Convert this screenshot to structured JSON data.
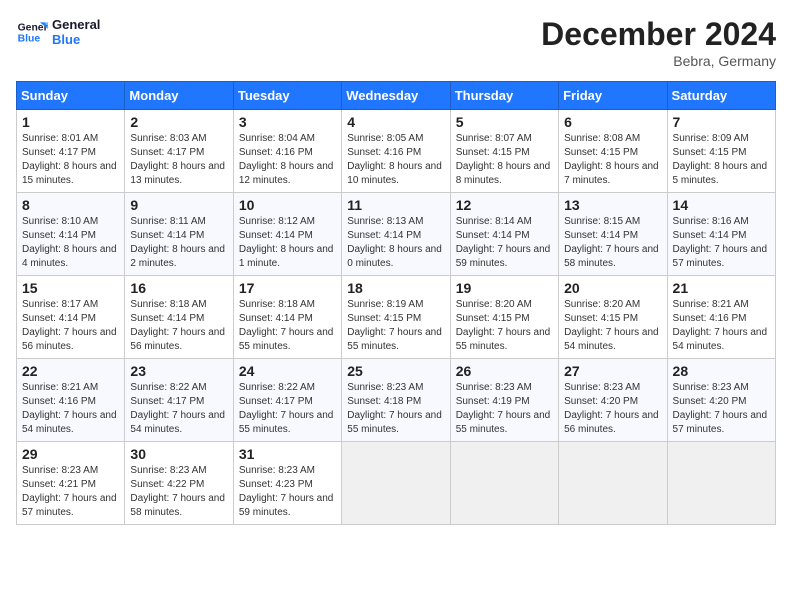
{
  "header": {
    "logo_line1": "General",
    "logo_line2": "Blue",
    "month_year": "December 2024",
    "location": "Bebra, Germany"
  },
  "weekdays": [
    "Sunday",
    "Monday",
    "Tuesday",
    "Wednesday",
    "Thursday",
    "Friday",
    "Saturday"
  ],
  "weeks": [
    [
      {
        "day": "1",
        "info": "Sunrise: 8:01 AM\nSunset: 4:17 PM\nDaylight: 8 hours and 15 minutes."
      },
      {
        "day": "2",
        "info": "Sunrise: 8:03 AM\nSunset: 4:17 PM\nDaylight: 8 hours and 13 minutes."
      },
      {
        "day": "3",
        "info": "Sunrise: 8:04 AM\nSunset: 4:16 PM\nDaylight: 8 hours and 12 minutes."
      },
      {
        "day": "4",
        "info": "Sunrise: 8:05 AM\nSunset: 4:16 PM\nDaylight: 8 hours and 10 minutes."
      },
      {
        "day": "5",
        "info": "Sunrise: 8:07 AM\nSunset: 4:15 PM\nDaylight: 8 hours and 8 minutes."
      },
      {
        "day": "6",
        "info": "Sunrise: 8:08 AM\nSunset: 4:15 PM\nDaylight: 8 hours and 7 minutes."
      },
      {
        "day": "7",
        "info": "Sunrise: 8:09 AM\nSunset: 4:15 PM\nDaylight: 8 hours and 5 minutes."
      }
    ],
    [
      {
        "day": "8",
        "info": "Sunrise: 8:10 AM\nSunset: 4:14 PM\nDaylight: 8 hours and 4 minutes."
      },
      {
        "day": "9",
        "info": "Sunrise: 8:11 AM\nSunset: 4:14 PM\nDaylight: 8 hours and 2 minutes."
      },
      {
        "day": "10",
        "info": "Sunrise: 8:12 AM\nSunset: 4:14 PM\nDaylight: 8 hours and 1 minute."
      },
      {
        "day": "11",
        "info": "Sunrise: 8:13 AM\nSunset: 4:14 PM\nDaylight: 8 hours and 0 minutes."
      },
      {
        "day": "12",
        "info": "Sunrise: 8:14 AM\nSunset: 4:14 PM\nDaylight: 7 hours and 59 minutes."
      },
      {
        "day": "13",
        "info": "Sunrise: 8:15 AM\nSunset: 4:14 PM\nDaylight: 7 hours and 58 minutes."
      },
      {
        "day": "14",
        "info": "Sunrise: 8:16 AM\nSunset: 4:14 PM\nDaylight: 7 hours and 57 minutes."
      }
    ],
    [
      {
        "day": "15",
        "info": "Sunrise: 8:17 AM\nSunset: 4:14 PM\nDaylight: 7 hours and 56 minutes."
      },
      {
        "day": "16",
        "info": "Sunrise: 8:18 AM\nSunset: 4:14 PM\nDaylight: 7 hours and 56 minutes."
      },
      {
        "day": "17",
        "info": "Sunrise: 8:18 AM\nSunset: 4:14 PM\nDaylight: 7 hours and 55 minutes."
      },
      {
        "day": "18",
        "info": "Sunrise: 8:19 AM\nSunset: 4:15 PM\nDaylight: 7 hours and 55 minutes."
      },
      {
        "day": "19",
        "info": "Sunrise: 8:20 AM\nSunset: 4:15 PM\nDaylight: 7 hours and 55 minutes."
      },
      {
        "day": "20",
        "info": "Sunrise: 8:20 AM\nSunset: 4:15 PM\nDaylight: 7 hours and 54 minutes."
      },
      {
        "day": "21",
        "info": "Sunrise: 8:21 AM\nSunset: 4:16 PM\nDaylight: 7 hours and 54 minutes."
      }
    ],
    [
      {
        "day": "22",
        "info": "Sunrise: 8:21 AM\nSunset: 4:16 PM\nDaylight: 7 hours and 54 minutes."
      },
      {
        "day": "23",
        "info": "Sunrise: 8:22 AM\nSunset: 4:17 PM\nDaylight: 7 hours and 54 minutes."
      },
      {
        "day": "24",
        "info": "Sunrise: 8:22 AM\nSunset: 4:17 PM\nDaylight: 7 hours and 55 minutes."
      },
      {
        "day": "25",
        "info": "Sunrise: 8:23 AM\nSunset: 4:18 PM\nDaylight: 7 hours and 55 minutes."
      },
      {
        "day": "26",
        "info": "Sunrise: 8:23 AM\nSunset: 4:19 PM\nDaylight: 7 hours and 55 minutes."
      },
      {
        "day": "27",
        "info": "Sunrise: 8:23 AM\nSunset: 4:20 PM\nDaylight: 7 hours and 56 minutes."
      },
      {
        "day": "28",
        "info": "Sunrise: 8:23 AM\nSunset: 4:20 PM\nDaylight: 7 hours and 57 minutes."
      }
    ],
    [
      {
        "day": "29",
        "info": "Sunrise: 8:23 AM\nSunset: 4:21 PM\nDaylight: 7 hours and 57 minutes."
      },
      {
        "day": "30",
        "info": "Sunrise: 8:23 AM\nSunset: 4:22 PM\nDaylight: 7 hours and 58 minutes."
      },
      {
        "day": "31",
        "info": "Sunrise: 8:23 AM\nSunset: 4:23 PM\nDaylight: 7 hours and 59 minutes."
      },
      null,
      null,
      null,
      null
    ]
  ]
}
